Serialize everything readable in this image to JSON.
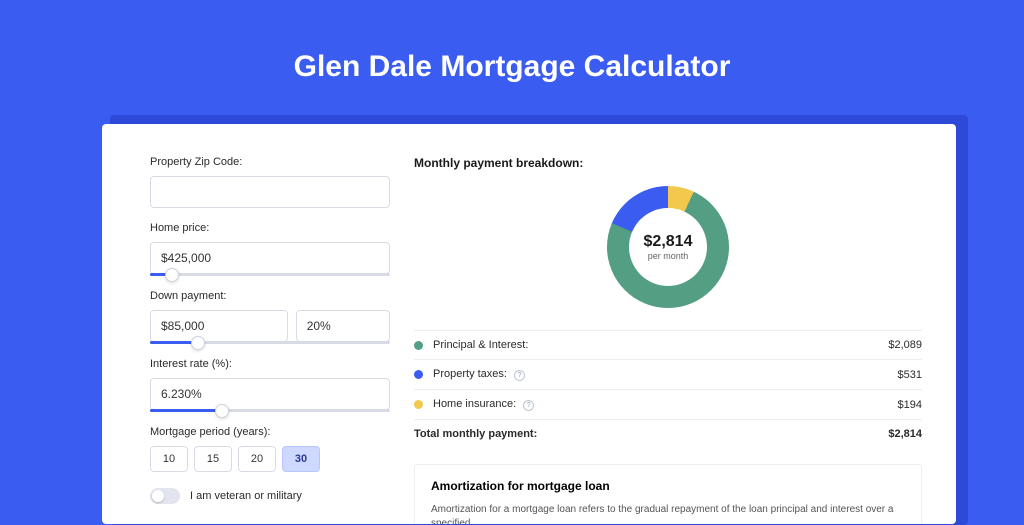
{
  "title": "Glen Dale Mortgage Calculator",
  "form": {
    "zip": {
      "label": "Property Zip Code:",
      "value": ""
    },
    "home_price": {
      "label": "Home price:",
      "value": "$425,000",
      "slider_pct": 9
    },
    "down_payment": {
      "label": "Down payment:",
      "amount": "$85,000",
      "percent": "20%",
      "slider_pct": 20
    },
    "interest_rate": {
      "label": "Interest rate (%):",
      "value": "6.230%",
      "slider_pct": 30
    },
    "period": {
      "label": "Mortgage period (years):",
      "options": [
        "10",
        "15",
        "20",
        "30"
      ],
      "selected": "30"
    },
    "veteran": {
      "label": "I am veteran or military",
      "on": false
    }
  },
  "breakdown": {
    "title": "Monthly payment breakdown:",
    "total": "$2,814",
    "total_sub": "per month",
    "items": [
      {
        "label": "Principal & Interest:",
        "value": "$2,089",
        "color": "green",
        "info": false
      },
      {
        "label": "Property taxes:",
        "value": "$531",
        "color": "blue",
        "info": true
      },
      {
        "label": "Home insurance:",
        "value": "$194",
        "color": "yellow",
        "info": true
      }
    ],
    "total_label": "Total monthly payment:",
    "total_value": "$2,814"
  },
  "amortization": {
    "title": "Amortization for mortgage loan",
    "text": "Amortization for a mortgage loan refers to the gradual repayment of the loan principal and interest over a specified"
  },
  "chart_data": {
    "type": "pie",
    "title": "Monthly payment breakdown",
    "series": [
      {
        "name": "Principal & Interest",
        "value": 2089,
        "color": "#549e83"
      },
      {
        "name": "Property taxes",
        "value": 531,
        "color": "#3a5cf0"
      },
      {
        "name": "Home insurance",
        "value": 194,
        "color": "#f2c94c"
      }
    ],
    "total": 2814,
    "unit": "USD per month"
  }
}
